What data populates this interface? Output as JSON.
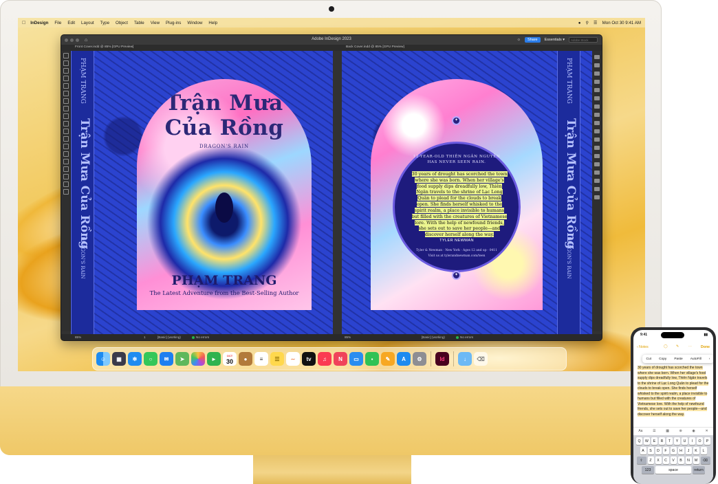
{
  "menubar": {
    "app": "InDesign",
    "items": [
      "File",
      "Edit",
      "Layout",
      "Type",
      "Object",
      "Table",
      "View",
      "Plug-ins",
      "Window",
      "Help"
    ],
    "clock": "Mon Oct 30  9:41 AM"
  },
  "indesign": {
    "title": "Adobe InDesign 2023",
    "share_label": "Share",
    "workspace": "Essentials",
    "stock_placeholder": "Adobe Stock",
    "tab_front": "Front Cover.indd @ 85% [GPU Preview]",
    "tab_back": "Back Cover.indd @ 85% [GPU Preview]",
    "status": {
      "zoom": "85%",
      "page": "1",
      "style": "[Basic] (working)",
      "errors": "No errors"
    }
  },
  "front_cover": {
    "title_line1": "Trận Mưa",
    "title_line2": "Của Rồng",
    "subtitle": "DRAGON'S RAIN",
    "author": "PHẠM TRANG",
    "tagline": "The Latest Adventure from the Best-Selling Author",
    "spine_author": "PHẠM TRANG",
    "spine_title": "Trận Mưa Của Rồng",
    "spine_subtitle": "DRAGON'S RAIN"
  },
  "back_cover": {
    "hook_line1": "12-YEAR-OLD THIÊN NGÂN NGUYỄN",
    "hook_line2": "HAS NEVER SEEN RAIN.",
    "blurb": "30 years of drought has scorched the town where she was born. When her village's food supply dips dreadfully low, Thiên Ngân travels to the shrine of Lạc Long Quân to plead for the clouds to break open. She finds herself whisked to the spirit realm, a place invisible to humans but filled with the creatures of Vietnamese lore. With the help of newfound friends, she sets out to save her people—and discover herself along the way.",
    "publisher": "TYLER NEWMAN",
    "pub_line": "Tyler & Newman · New York · Ages 12 and up · 0411",
    "pub_url": "Visit us at tylerandnewman.com/teen",
    "spine_author": "PHẠM TRANG",
    "spine_title": "Trận Mưa Của Rồng",
    "spine_subtitle": "DRAGON'S RAIN"
  },
  "dock": {
    "calendar_month": "OCT",
    "calendar_day": "30",
    "tv_label": "tv",
    "indesign_label": "Id"
  },
  "iphone": {
    "time": "9:41",
    "back_label": "Notes",
    "done_label": "Done",
    "edit_menu": [
      "Cut",
      "Copy",
      "Paste",
      "AutoFill"
    ],
    "note_text": "30 years of drought has scorched the town where she was born. When her village's food supply dips dreadfully low, Thiên Ngân travels to the shrine of Lạc Long Quân to plead for the clouds to break open. She finds herself whisked to the spirit realm, a place invisible to humans but filled with the creatures of Vietnamese lore. With the help of newfound friends, she sets out to save her people—and discover herself along the way.",
    "format_label": "Aa",
    "keys_row1": [
      "Q",
      "W",
      "E",
      "R",
      "T",
      "Y",
      "U",
      "I",
      "O",
      "P"
    ],
    "keys_row2": [
      "A",
      "S",
      "D",
      "F",
      "G",
      "H",
      "J",
      "K",
      "L"
    ],
    "keys_row3": [
      "Z",
      "X",
      "C",
      "V",
      "B",
      "N",
      "M"
    ],
    "key_123": "123",
    "key_space": "space",
    "key_return": "return"
  },
  "colors": {
    "accent_blue": "#2b7de9",
    "cover_blue": "#2b43cf",
    "highlight": "#ecf58f",
    "imac_yellow": "#f3d588"
  }
}
